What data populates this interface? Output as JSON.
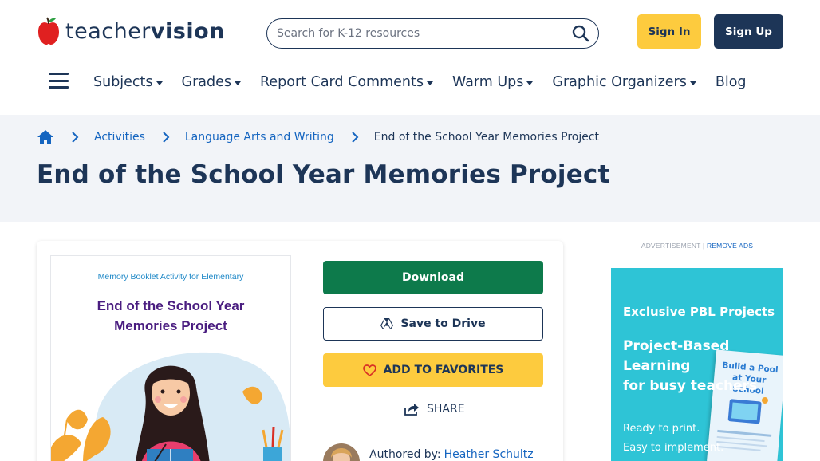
{
  "brand": {
    "logo_thin": "teacher",
    "logo_bold": "vision",
    "accent": "#fdcb3e",
    "navy": "#1d3557",
    "link": "#1565c0",
    "download_green": "#0d7a4b"
  },
  "search": {
    "placeholder": "Search for K-12 resources"
  },
  "auth": {
    "sign_in": "Sign In",
    "sign_up": "Sign Up"
  },
  "nav": {
    "items": [
      {
        "label": "Subjects"
      },
      {
        "label": "Grades"
      },
      {
        "label": "Report Card Comments"
      },
      {
        "label": "Warm Ups"
      },
      {
        "label": "Graphic Organizers"
      },
      {
        "label": "Blog"
      }
    ]
  },
  "breadcrumb": {
    "items": [
      {
        "label": "Activities"
      },
      {
        "label": "Language Arts and Writing"
      },
      {
        "label": "End of the School Year Memories Project"
      }
    ]
  },
  "page": {
    "title": "End of the School Year Memories Project"
  },
  "resource": {
    "thumb_subtitle": "Memory Booklet Activity for Elementary",
    "thumb_title_line1": "End of the School Year",
    "thumb_title_line2": "Memories Project",
    "download_label": "Download",
    "drive_label": "Save to Drive",
    "favorites_label": "ADD TO FAVORITES",
    "share_label": "SHARE",
    "author_prefix": "Authored by:",
    "author_name": "Heather Schultz"
  },
  "ad": {
    "label": "ADVERTISEMENT |",
    "remove": "REMOVE ADS",
    "headline": "Exclusive PBL Projects",
    "title_line1": "Project-Based",
    "title_line2": "Learning",
    "title_line3": "for busy teachers",
    "body_line1": "Ready to print.",
    "body_line2": "Easy to implement.",
    "book_title": "Build a Pool at Your School"
  }
}
